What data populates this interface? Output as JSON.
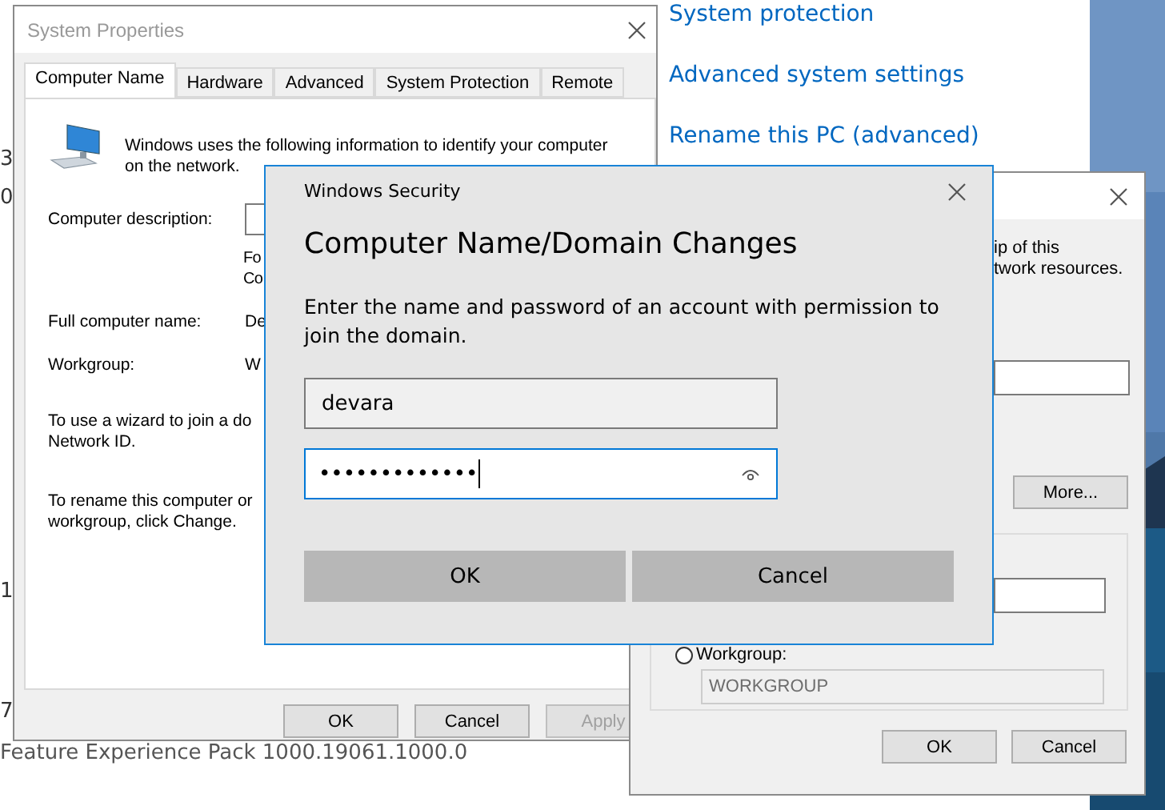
{
  "background_page": {
    "fragments": [
      "3",
      "0",
      "1",
      "7"
    ],
    "footer_text": "Feature Experience Pack 1000.19061.1000.0",
    "links": [
      "System protection",
      "Advanced system settings",
      "Rename this PC (advanced)"
    ]
  },
  "system_properties": {
    "title": "System Properties",
    "tabs": [
      {
        "label": "Computer Name",
        "selected": true
      },
      {
        "label": "Hardware",
        "selected": false
      },
      {
        "label": "Advanced",
        "selected": false
      },
      {
        "label": "System Protection",
        "selected": false
      },
      {
        "label": "Remote",
        "selected": false
      }
    ],
    "intro_lines": [
      "Windows uses the following information to identify your computer",
      "on the network."
    ],
    "rows": [
      {
        "kind": "field",
        "label": "Computer description:",
        "hint_lines": [
          "Fo",
          "Co"
        ]
      },
      {
        "kind": "text",
        "label": "Full computer name:",
        "value": "De"
      },
      {
        "kind": "text",
        "label": "Workgroup:",
        "value": "W"
      }
    ],
    "paragraphs": [
      [
        "To use a wizard to join a do",
        "Network ID."
      ],
      [
        "To rename this computer or",
        "workgroup, click Change."
      ]
    ],
    "buttons": [
      {
        "label": "OK",
        "disabled": false
      },
      {
        "label": "Cancel",
        "disabled": false
      },
      {
        "label": "Apply",
        "disabled": true
      }
    ]
  },
  "name_changes_window": {
    "text_lines": [
      "ip of this",
      "twork resources."
    ],
    "more_button": "More...",
    "workgroup_option": {
      "label": "Workgroup:",
      "selected": false
    },
    "workgroup_field": {
      "value": "WORKGROUP",
      "disabled": true
    },
    "buttons": [
      "OK",
      "Cancel"
    ]
  },
  "security_dialog": {
    "app": "Windows Security",
    "heading": "Computer Name/Domain Changes",
    "message": "Enter the name and password of an account with permission to join the domain.",
    "username": {
      "value": "devara"
    },
    "password": {
      "value": "•••••••••••••",
      "focused": true
    },
    "buttons": [
      "OK",
      "Cancel"
    ]
  }
}
